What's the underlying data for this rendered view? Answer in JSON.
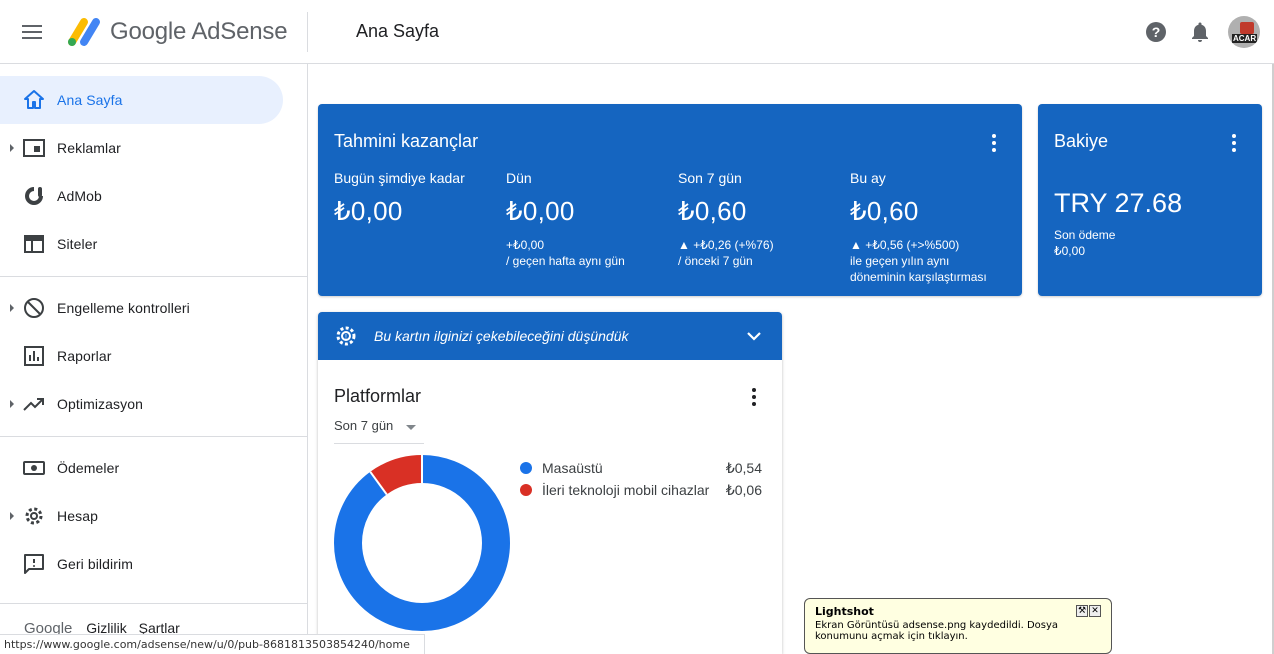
{
  "header": {
    "brand": "Google AdSense",
    "page_title": "Ana Sayfa"
  },
  "sidebar": {
    "items": [
      {
        "label": "Ana Sayfa",
        "icon": "home-icon",
        "active": true,
        "expandable": false
      },
      {
        "label": "Reklamlar",
        "icon": "ads-icon",
        "active": false,
        "expandable": true
      },
      {
        "label": "AdMob",
        "icon": "admob-icon",
        "active": false,
        "expandable": false
      },
      {
        "label": "Siteler",
        "icon": "sites-icon",
        "active": false,
        "expandable": false
      },
      {
        "label": "Engelleme kontrolleri",
        "icon": "block-icon",
        "active": false,
        "expandable": true
      },
      {
        "label": "Raporlar",
        "icon": "reports-icon",
        "active": false,
        "expandable": false
      },
      {
        "label": "Optimizasyon",
        "icon": "trending-icon",
        "active": false,
        "expandable": true
      },
      {
        "label": "Ödemeler",
        "icon": "payments-icon",
        "active": false,
        "expandable": false
      },
      {
        "label": "Hesap",
        "icon": "gear-icon",
        "active": false,
        "expandable": true
      },
      {
        "label": "Geri bildirim",
        "icon": "feedback-icon",
        "active": false,
        "expandable": false
      }
    ],
    "footer": {
      "google": "Google",
      "privacy": "Gizlilik",
      "terms": "Şartlar"
    }
  },
  "earnings": {
    "title": "Tahmini kazançlar",
    "metrics": [
      {
        "label": "Bugün şimdiye kadar",
        "value": "₺0,00",
        "sub1": "",
        "sub2": "",
        "sub3": ""
      },
      {
        "label": "Dün",
        "value": "₺0,00",
        "sub1": "+₺0,00",
        "sub2": "/ geçen hafta aynı gün",
        "sub3": ""
      },
      {
        "label": "Son 7 gün",
        "value": "₺0,60",
        "sub1": "▲ +₺0,26 (+%76)",
        "sub2": "/ önceki 7 gün",
        "sub3": ""
      },
      {
        "label": "Bu ay",
        "value": "₺0,60",
        "sub1": "▲ +₺0,56 (+>%500)",
        "sub2": "ile geçen yılın aynı",
        "sub3": "döneminin karşılaştırması"
      }
    ]
  },
  "balance": {
    "title": "Bakiye",
    "value": "TRY 27.68",
    "last_payment_label": "Son ödeme",
    "last_payment_value": "₺0,00"
  },
  "promo": {
    "text": "Bu kartın ilginizi çekebileceğini düşündük"
  },
  "platforms": {
    "title": "Platformlar",
    "range": "Son 7 gün",
    "legend": [
      {
        "name": "Masaüstü",
        "value": "₺0,54",
        "color": "#1a73e8"
      },
      {
        "name": "İleri teknoloji mobil cihazlar",
        "value": "₺0,06",
        "color": "#d93025"
      }
    ]
  },
  "chart_data": {
    "type": "pie",
    "categories": [
      "Masaüstü",
      "İleri teknoloji mobil cihazlar"
    ],
    "values": [
      0.54,
      0.06
    ],
    "colors": [
      "#1a73e8",
      "#d93025"
    ]
  },
  "statusbar": {
    "url": "https://www.google.com/adsense/new/u/0/pub-8681813503854240/home"
  },
  "toast": {
    "title": "Lightshot",
    "message": "Ekran Görüntüsü adsense.png kaydedildi. Dosya konumunu açmak için tıklayın."
  },
  "avatar_text": "ACAR",
  "colors": {
    "primary": "#1565c0",
    "accent": "#1a73e8",
    "danger": "#d93025"
  }
}
